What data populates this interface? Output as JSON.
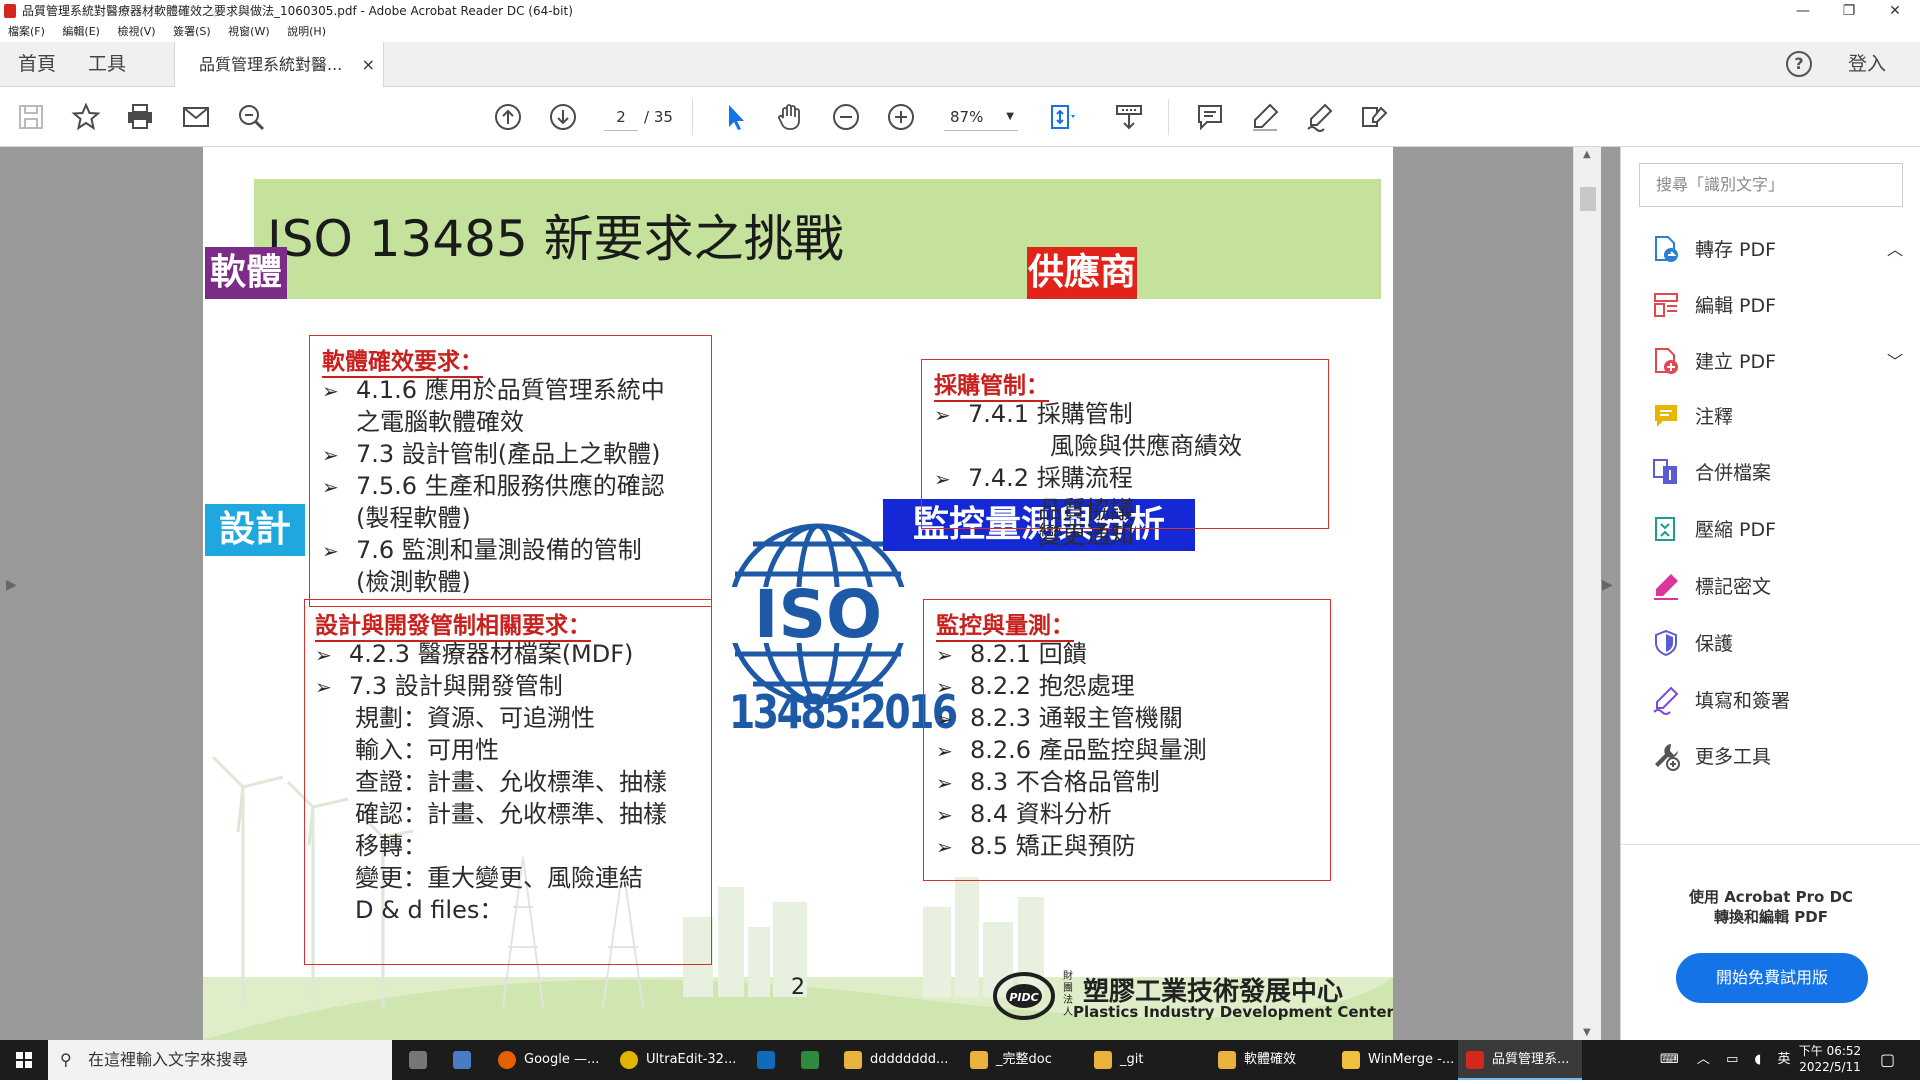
{
  "window": {
    "title": "品質管理系統對醫療器材軟體確效之要求與做法_1060305.pdf - Adobe Acrobat Reader DC (64-bit)",
    "menu": [
      "檔案(F)",
      "編輯(E)",
      "檢視(V)",
      "簽署(S)",
      "視窗(W)",
      "說明(H)"
    ]
  },
  "tabs": {
    "home": "首頁",
    "tools": "工具",
    "document": "品質管理系統對醫...",
    "close": "×",
    "help": "?",
    "signin": "登入"
  },
  "toolbar": {
    "page_current": "2",
    "page_total": "/ 35",
    "zoom": "87%"
  },
  "slide": {
    "title": "ISO 13485 新要求之挑戰",
    "tags": {
      "software": "軟體",
      "supplier": "供應商",
      "design": "設計",
      "monitor": "監控量測與分析"
    },
    "software_box": {
      "heading": "軟體確效要求：",
      "lines": [
        "4.1.6 應用於品質管理系統中",
        "之電腦軟體確效",
        "7.3 設計管制(產品上之軟體)",
        "7.5.6  生產和服務供應的確認",
        "(製程軟體)",
        "7.6 監測和量測設備的管制",
        "(檢測軟體)"
      ]
    },
    "supplier_box": {
      "heading": "採購管制：",
      "lines": [
        "7.4.1  採購管制",
        "風險與供應商績效",
        "7.4.2 採購流程",
        "品質協議",
        "變更通知"
      ]
    },
    "design_box": {
      "heading": "設計與開發管制相關要求：",
      "lines": [
        "4.2.3 醫療器材檔案(MDF)",
        "7.3 設計與開發管制",
        "規劃：資源、可追溯性",
        "輸入：可用性",
        "查證：計畫、允收標準、抽樣",
        "確認：計畫、允收標準、抽樣",
        "移轉：",
        "變更：重大變更、風險連結",
        "D & d files："
      ]
    },
    "monitor_box": {
      "heading": "監控與量測：",
      "lines": [
        "8.2.1  回饋",
        "8.2.2 抱怨處理",
        "8.2.3 通報主管機關",
        "8.2.6 產品監控與量測",
        "8.3 不合格品管制",
        "8.4 資料分析",
        "8.5 矯正與預防"
      ]
    },
    "iso_text": "ISO",
    "iso_year": "13485:2016",
    "page_number": "2",
    "org_small": "財團法人",
    "org_cn": "塑膠工業技術發展中心",
    "org_en": "Plastics Industry Development Center",
    "org_logo": "PIDC"
  },
  "right_panel": {
    "search_placeholder": "搜尋「識別文字」",
    "tools": [
      {
        "label": "轉存 PDF",
        "color": "#2d7fd3"
      },
      {
        "label": "編輯 PDF",
        "color": "#e34850"
      },
      {
        "label": "建立 PDF",
        "color": "#e34850"
      },
      {
        "label": "注釋",
        "color": "#e8b600"
      },
      {
        "label": "合併檔案",
        "color": "#5b5bd6"
      },
      {
        "label": "壓縮 PDF",
        "color": "#1a9e8f"
      },
      {
        "label": "標記密文",
        "color": "#d9359b"
      },
      {
        "label": "保護",
        "color": "#5b5bd6"
      },
      {
        "label": "填寫和簽署",
        "color": "#7b4bd6"
      },
      {
        "label": "更多工具",
        "color": "#555555"
      }
    ],
    "promo": [
      "使用 Acrobat Pro DC",
      "轉換和編輯 PDF"
    ],
    "trial_button": "開始免費試用版"
  },
  "taskbar": {
    "search_placeholder": "在這裡輸入文字來搜尋",
    "apps": [
      {
        "label": "Google —..."
      },
      {
        "label": "UltraEdit-32..."
      },
      {
        "label": "dddddddd..."
      },
      {
        "label": "_完整doc"
      },
      {
        "label": "_git"
      },
      {
        "label": "軟體確效"
      },
      {
        "label": "WinMerge -..."
      },
      {
        "label": "品質管理系..."
      }
    ],
    "ime": "英",
    "time": "下午 06:52",
    "date": "2022/5/11"
  },
  "colors": {
    "title_bg": "#c5e29c",
    "tag_software": "#7b2c87",
    "tag_supplier": "#e2231a",
    "tag_design": "#1fa8e0",
    "tag_monitor": "#1428d6",
    "box_border": "#d8312c",
    "iso_blue": "#1d59a6"
  }
}
